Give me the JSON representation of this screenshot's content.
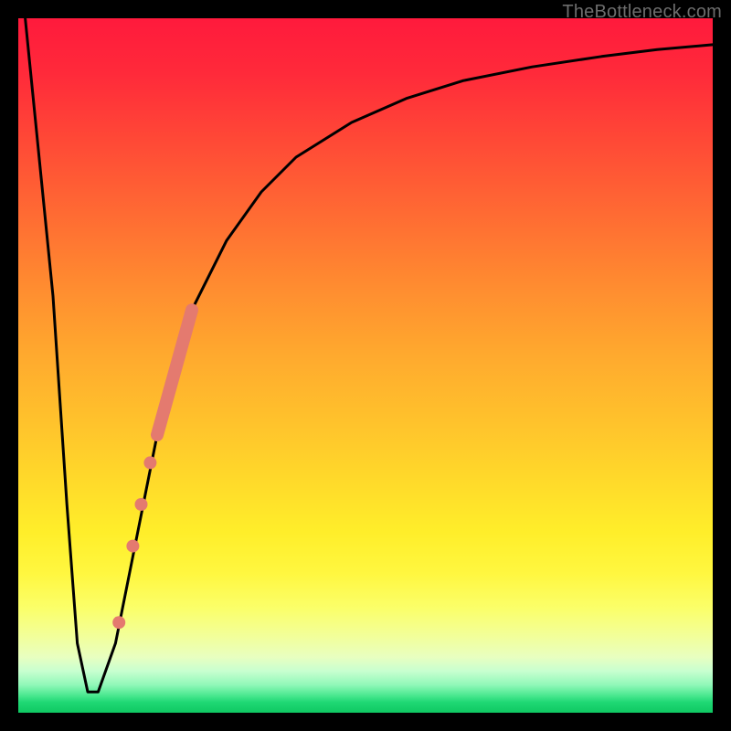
{
  "watermark": "TheBottleneck.com",
  "colors": {
    "curve": "#000000",
    "marker": "#e47a6f",
    "frame": "#000000"
  },
  "chart_data": {
    "type": "line",
    "title": "",
    "xlabel": "",
    "ylabel": "",
    "xlim": [
      0,
      100
    ],
    "ylim": [
      0,
      100
    ],
    "grid": false,
    "legend": false,
    "series": [
      {
        "name": "bottleneck-curve",
        "x": [
          1,
          5,
          7,
          8.5,
          10,
          11.5,
          14,
          16,
          20,
          25,
          30,
          35,
          40,
          48,
          56,
          64,
          74,
          84,
          92,
          100
        ],
        "y": [
          100,
          60,
          30,
          10,
          3,
          3,
          10,
          20,
          40,
          58,
          68,
          75,
          80,
          85,
          88.5,
          91,
          93,
          94.5,
          95.5,
          96.2
        ]
      }
    ],
    "thick_segment": {
      "name": "highlighted-range",
      "color": "#e47a6f",
      "x": [
        20,
        25
      ],
      "y": [
        40,
        58
      ]
    },
    "markers": [
      {
        "x": 16.5,
        "y": 24
      },
      {
        "x": 17.7,
        "y": 30
      },
      {
        "x": 19.0,
        "y": 36
      },
      {
        "x": 14.5,
        "y": 13
      }
    ]
  }
}
